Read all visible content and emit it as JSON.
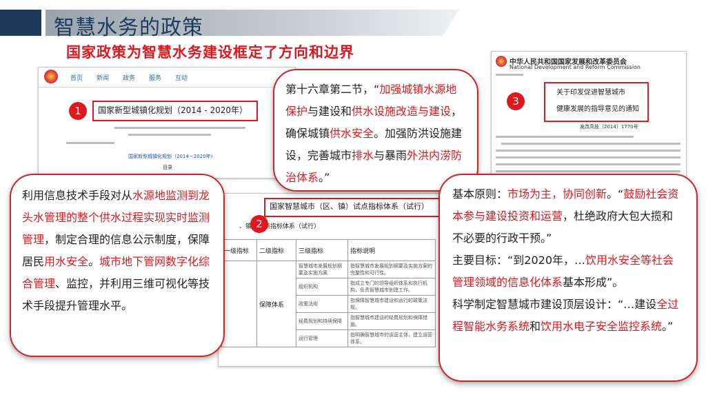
{
  "header": {
    "title": "智慧水务的政策",
    "subtitle": "国家政策为智慧水务建设框定了方向和边界"
  },
  "shot1": {
    "badge": "1",
    "doc_title": "国家新型城镇化规划（2014 - 2020年）",
    "nav_items": [
      "首页",
      "新闻",
      "政务",
      "服务",
      "互动"
    ],
    "link_text": "国家新型城镇化规划（2014－2020年）",
    "toc_label": "目录"
  },
  "shot2": {
    "badge": "2",
    "table_title": "国家智慧城市（区、镇）试点指标体系（试行）",
    "table_subtitle": "、镇）试点指标体系（试行）",
    "headers": [
      "一级指标",
      "二级指标",
      "三级指标",
      "指标说明"
    ],
    "first_level": "保障体系",
    "rows": [
      {
        "third": "智慧城市发展规划纲要及实施方案",
        "desc": "指智慧城市发展规划纲要及实施方案的完整性和可行性。"
      },
      {
        "third": "组织机构",
        "desc": "指成立专门的领导组织体系和执行机构，负责智慧城市创建工作。"
      },
      {
        "third": "政策法规",
        "desc": "指保障智慧城市建设和运行的政策法规。"
      },
      {
        "third": "经费规划和持续保障",
        "desc": "指智慧城市建设的经费规划和保障措施。"
      },
      {
        "third": "运行管理",
        "desc": "指明确智慧城市的运营主体，建立运营体系。"
      }
    ]
  },
  "shot3": {
    "badge": "3",
    "org_cn": "中华人民共和国国家发展和改革委员会",
    "org_en": "National Development and Reform Commission",
    "notice_line1": "关于印发促进智慧城市",
    "notice_line2": "健康发展的指导意见的通知",
    "doc_no": "发改高技〔2014〕1770号"
  },
  "callout_mid": {
    "segments": [
      {
        "t": "第十六章第二节，“",
        "r": false
      },
      {
        "t": "加强城镇水源地保护",
        "r": true
      },
      {
        "t": "与建设和",
        "r": false
      },
      {
        "t": "供水设施改造与建设",
        "r": true
      },
      {
        "t": "，确保城镇",
        "r": false
      },
      {
        "t": "供水安全",
        "r": true
      },
      {
        "t": "。加强防洪设施建设，完善城市",
        "r": false
      },
      {
        "t": "排水",
        "r": true
      },
      {
        "t": "与暴雨",
        "r": false
      },
      {
        "t": "外洪内涝防治体系",
        "r": true
      },
      {
        "t": "。”",
        "r": false
      }
    ]
  },
  "callout_left": {
    "segments": [
      {
        "t": "利用信息技术手段对从",
        "r": false
      },
      {
        "t": "水源地监测到龙头水管理的整个供水过程实现实时监测管理",
        "r": true
      },
      {
        "t": "，制定合理的信息公示制度，保障居民",
        "r": false
      },
      {
        "t": "用水安全",
        "r": true
      },
      {
        "t": "。",
        "r": false
      },
      {
        "t": "城市地下管网数字化综合管理",
        "r": true
      },
      {
        "t": "、监控，并利用三维可视化等技术手段提升管理水平。",
        "r": false
      }
    ]
  },
  "callout_right": {
    "paragraphs": [
      [
        {
          "t": "基本原则：",
          "r": false
        },
        {
          "t": "市场为主，协同创新",
          "r": true
        },
        {
          "t": "。“",
          "r": false
        },
        {
          "t": "鼓励社会资本参与建设投资和运营",
          "r": true
        },
        {
          "t": "，杜绝政府大包大揽和不必要的行政干预。”",
          "r": false
        }
      ],
      [
        {
          "t": "主要目标：“到2020年，…",
          "r": false
        },
        {
          "t": "饮用水安全等社会管理领域的信息化体系",
          "r": true
        },
        {
          "t": "基本形成”。",
          "r": false
        }
      ],
      [
        {
          "t": "科学制定智慧城市建设顶层设计：“…建设",
          "r": false
        },
        {
          "t": "全过程智能水务系统",
          "r": true
        },
        {
          "t": "和",
          "r": false
        },
        {
          "t": "饮用水电子安全监控系统",
          "r": true
        },
        {
          "t": "。”",
          "r": false
        }
      ]
    ]
  },
  "colors": {
    "accent_red": "#e0171e",
    "title_navy": "#1f3c60",
    "header_dark": "#1e3a5a"
  }
}
